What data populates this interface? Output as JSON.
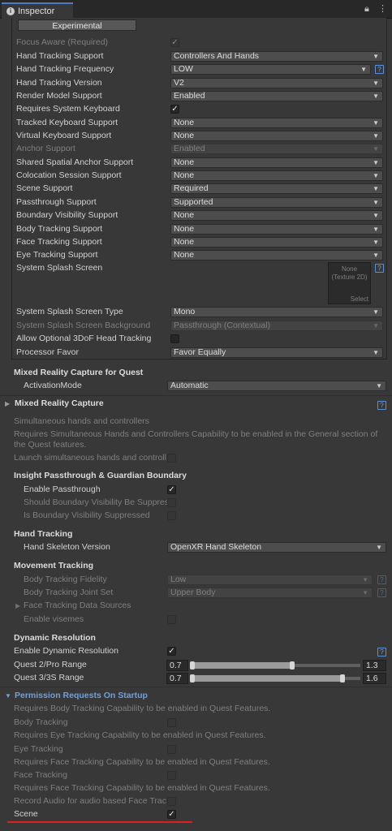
{
  "window": {
    "tab_label": "Inspector"
  },
  "buttons": {
    "experimental": "Experimental",
    "texture_select": "Select"
  },
  "texture": {
    "line1": "None",
    "line2": "(Texture 2D)"
  },
  "help_label": "?",
  "settings": [
    {
      "label": "Focus Aware (Required)",
      "control": "checkbox",
      "value": "checked",
      "disabled": true
    },
    {
      "label": "Hand Tracking Support",
      "control": "dropdown",
      "value": "Controllers And Hands"
    },
    {
      "label": "Hand Tracking Frequency",
      "control": "dropdown",
      "value": "LOW"
    },
    {
      "label": "Hand Tracking Version",
      "control": "dropdown",
      "value": "V2"
    },
    {
      "label": "Render Model Support",
      "control": "dropdown",
      "value": "Enabled"
    },
    {
      "label": "Requires System Keyboard",
      "control": "checkbox",
      "value": "checked"
    },
    {
      "label": "Tracked Keyboard Support",
      "control": "dropdown",
      "value": "None"
    },
    {
      "label": "Virtual Keyboard Support",
      "control": "dropdown",
      "value": "None"
    },
    {
      "label": "Anchor Support",
      "control": "dropdown",
      "value": "Enabled",
      "disabled": true
    },
    {
      "label": "Shared Spatial Anchor Support",
      "control": "dropdown",
      "value": "None"
    },
    {
      "label": "Colocation Session Support",
      "control": "dropdown",
      "value": "None"
    },
    {
      "label": "Scene Support",
      "control": "dropdown",
      "value": "Required"
    },
    {
      "label": "Passthrough Support",
      "control": "dropdown",
      "value": "Supported"
    },
    {
      "label": "Boundary Visibility Support",
      "control": "dropdown",
      "value": "None"
    },
    {
      "label": "Body Tracking Support",
      "control": "dropdown",
      "value": "None"
    },
    {
      "label": "Face Tracking Support",
      "control": "dropdown",
      "value": "None"
    },
    {
      "label": "Eye Tracking Support",
      "control": "dropdown",
      "value": "None"
    },
    {
      "label": "System Splash Screen",
      "control": "texture"
    },
    {
      "label": "System Splash Screen Type",
      "control": "dropdown",
      "value": "Mono"
    },
    {
      "label": "System Splash Screen Background",
      "control": "dropdown",
      "value": "Passthrough (Contextual)",
      "disabled": true
    },
    {
      "label": "Allow Optional 3DoF Head Tracking",
      "control": "checkbox",
      "value": "unchecked"
    },
    {
      "label": "Processor Favor",
      "control": "dropdown",
      "value": "Favor Equally"
    }
  ],
  "mrc_quest": {
    "header": "Mixed Reality Capture for Quest",
    "activation_label": "ActivationMode",
    "activation_value": "Automatic"
  },
  "mrc": {
    "header": "Mixed Reality Capture"
  },
  "simultaneous": {
    "header": "Simultaneous hands and controllers",
    "note_line1": "Requires Simultaneous Hands and Controllers Capability to be enabled in the General section of",
    "note_line2": "the Quest features.",
    "launch_label": "Launch simultaneous hands and controll"
  },
  "insight": {
    "header": "Insight Passthrough & Guardian Boundary",
    "enable_label": "Enable Passthrough",
    "should_label": "Should Boundary Visibility Be Suppres",
    "is_label": "Is Boundary Visibility Suppressed"
  },
  "hand_tracking": {
    "header": "Hand Tracking",
    "skeleton_label": "Hand Skeleton Version",
    "skeleton_value": "OpenXR Hand Skeleton"
  },
  "movement": {
    "header": "Movement Tracking",
    "fidelity_label": "Body Tracking Fidelity",
    "fidelity_value": "Low",
    "jointset_label": "Body Tracking Joint Set",
    "jointset_value": "Upper Body",
    "face_sources_label": "Face Tracking Data Sources",
    "visemes_label": "Enable visemes"
  },
  "dynamic_resolution": {
    "header": "Dynamic Resolution",
    "enable_label": "Enable Dynamic Resolution",
    "ranges": [
      {
        "label": "Quest 2/Pro Range",
        "min": "0.7",
        "max": "1.3",
        "min_frac": 0.0,
        "max_frac": 0.6
      },
      {
        "label": "Quest 3/3S Range",
        "min": "0.7",
        "max": "1.6",
        "min_frac": 0.0,
        "max_frac": 0.9
      }
    ]
  },
  "permissions": {
    "header": "Permission Requests On Startup",
    "body_note": "Requires Body Tracking Capability to be enabled in Quest Features.",
    "body_label": "Body Tracking",
    "eye_note": "Requires Eye Tracking Capability to be enabled in Quest Features.",
    "eye_label": "Eye Tracking",
    "face_note": "Requires Face Tracking Capability to be enabled in Quest Features.",
    "face_label": "Face Tracking",
    "face_note2": "Requires Face Tracking Capability to be enabled in Quest Features.",
    "record_label": "Record Audio for audio based Face Trac",
    "scene_label": "Scene"
  },
  "colors": {
    "background": "#383838",
    "accent_blue": "#6fa0dc",
    "highlight_red": "#e02020"
  }
}
